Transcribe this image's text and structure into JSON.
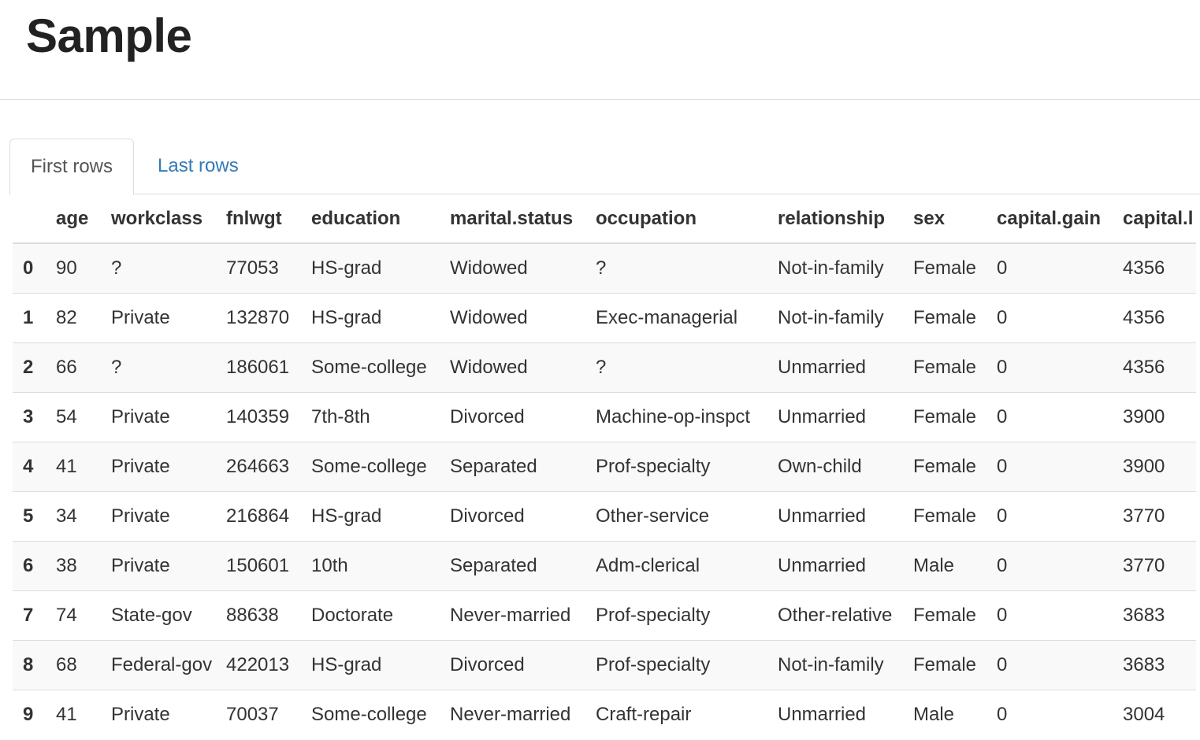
{
  "page": {
    "title": "Sample"
  },
  "tabs": [
    {
      "label": "First rows",
      "active": true
    },
    {
      "label": "Last rows",
      "active": false
    }
  ],
  "colors": {
    "link": "#337ab7",
    "stripe": "#f9f9f9",
    "border": "#dddddd"
  },
  "table": {
    "columns": [
      "",
      "age",
      "workclass",
      "fnlwgt",
      "education",
      "marital.status",
      "occupation",
      "relationship",
      "sex",
      "capital.gain",
      "capital.l"
    ],
    "rows": [
      [
        "0",
        "90",
        "?",
        "77053",
        "HS-grad",
        "Widowed",
        "?",
        "Not-in-family",
        "Female",
        "0",
        "4356"
      ],
      [
        "1",
        "82",
        "Private",
        "132870",
        "HS-grad",
        "Widowed",
        "Exec-managerial",
        "Not-in-family",
        "Female",
        "0",
        "4356"
      ],
      [
        "2",
        "66",
        "?",
        "186061",
        "Some-college",
        "Widowed",
        "?",
        "Unmarried",
        "Female",
        "0",
        "4356"
      ],
      [
        "3",
        "54",
        "Private",
        "140359",
        "7th-8th",
        "Divorced",
        "Machine-op-inspct",
        "Unmarried",
        "Female",
        "0",
        "3900"
      ],
      [
        "4",
        "41",
        "Private",
        "264663",
        "Some-college",
        "Separated",
        "Prof-specialty",
        "Own-child",
        "Female",
        "0",
        "3900"
      ],
      [
        "5",
        "34",
        "Private",
        "216864",
        "HS-grad",
        "Divorced",
        "Other-service",
        "Unmarried",
        "Female",
        "0",
        "3770"
      ],
      [
        "6",
        "38",
        "Private",
        "150601",
        "10th",
        "Separated",
        "Adm-clerical",
        "Unmarried",
        "Male",
        "0",
        "3770"
      ],
      [
        "7",
        "74",
        "State-gov",
        "88638",
        "Doctorate",
        "Never-married",
        "Prof-specialty",
        "Other-relative",
        "Female",
        "0",
        "3683"
      ],
      [
        "8",
        "68",
        "Federal-gov",
        "422013",
        "HS-grad",
        "Divorced",
        "Prof-specialty",
        "Not-in-family",
        "Female",
        "0",
        "3683"
      ],
      [
        "9",
        "41",
        "Private",
        "70037",
        "Some-college",
        "Never-married",
        "Craft-repair",
        "Unmarried",
        "Male",
        "0",
        "3004"
      ]
    ]
  }
}
